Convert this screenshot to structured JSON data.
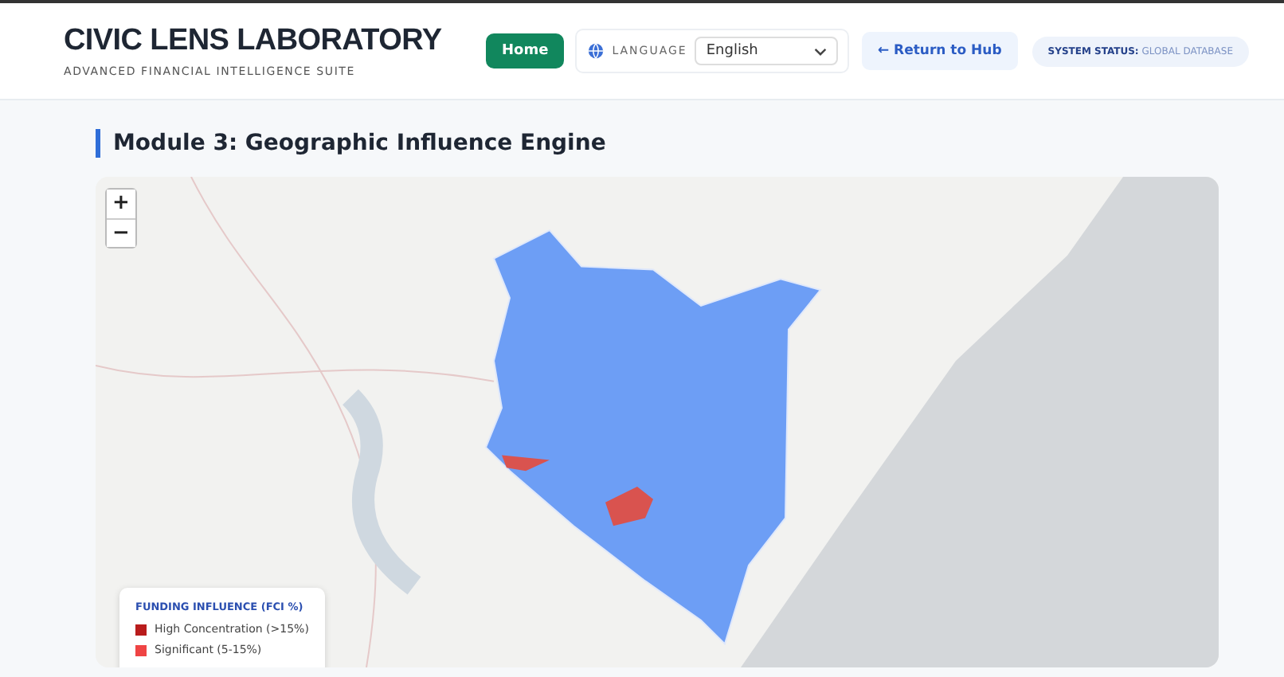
{
  "header": {
    "title": "CIVIC LENS LABORATORY",
    "subtitle": "ADVANCED FINANCIAL INTELLIGENCE SUITE",
    "home_button": "Home",
    "language": {
      "label": "LANGUAGE",
      "value": "English"
    },
    "return_button": "← Return to Hub",
    "status": {
      "label": "SYSTEM STATUS:",
      "value": "GLOBAL DATABASE"
    }
  },
  "module": {
    "title": "Module 3: Geographic Influence Engine"
  },
  "map": {
    "zoom_in": "+",
    "zoom_out": "−",
    "legend": {
      "title": "FUNDING INFLUENCE (FCI %)",
      "items": [
        {
          "label": "High Concentration (>15%)",
          "color": "#b91c1c"
        },
        {
          "label": "Significant (5-15%)",
          "color": "#ef4444"
        }
      ]
    }
  }
}
